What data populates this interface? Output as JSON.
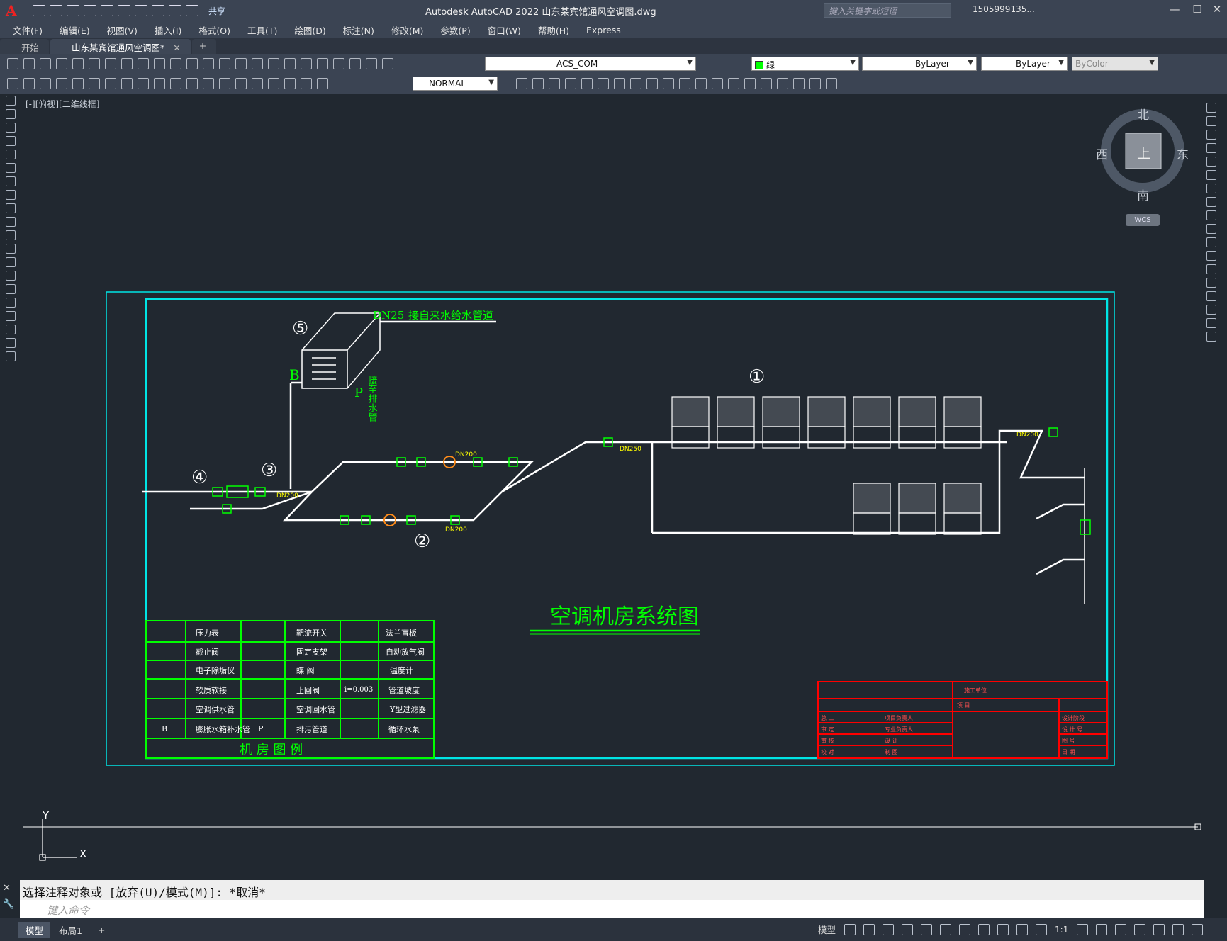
{
  "app": {
    "logo_letter": "A",
    "title": "Autodesk AutoCAD 2022    山东某宾馆通风空调图.dwg",
    "share": "共享",
    "search_placeholder": "键入关键字或短语",
    "user": "1505999135...",
    "window_controls": [
      "—",
      "☐",
      "✕"
    ]
  },
  "menu": [
    "文件(F)",
    "编辑(E)",
    "视图(V)",
    "插入(I)",
    "格式(O)",
    "工具(T)",
    "绘图(D)",
    "标注(N)",
    "修改(M)",
    "参数(P)",
    "窗口(W)",
    "帮助(H)",
    "Express"
  ],
  "tabs": [
    {
      "label": "开始"
    },
    {
      "label": "山东某宾馆通风空调图*"
    }
  ],
  "toolbar": {
    "layer": "ACS_COM",
    "color": "绿",
    "linetype": "ByLayer",
    "lineweight": "ByLayer",
    "plotstyle": "ByColor",
    "textstyle": "NORMAL"
  },
  "viewport": {
    "label": "[-][俯视][二维线框]"
  },
  "viewcube": {
    "north": "北",
    "south": "南",
    "east": "东",
    "west": "西",
    "face": "上",
    "wcs": "WCS"
  },
  "drawing": {
    "title": "空调机房系统图",
    "pipe_labels": {
      "dn25": "DN25",
      "water_supply": "接自来水给水管道",
      "dn200": "DN200",
      "dn250": "DN250",
      "bp_label": "B",
      "p_label": "P",
      "drain": "接至排水管"
    },
    "markers": [
      "①",
      "②",
      "③",
      "④",
      "⑤"
    ],
    "legend": {
      "footer": "机    房    图    例",
      "rows": [
        [
          "压力表",
          "靶流开关",
          "法兰盲板"
        ],
        [
          "截止阀",
          "固定支架",
          "自动放气阀"
        ],
        [
          "电子除垢仪",
          "蝶  阀",
          "温度计"
        ],
        [
          "软质软接",
          "止回阀",
          "管道坡度"
        ],
        [
          "空调供水管",
          "空调回水管",
          "Y型过滤器"
        ],
        [
          "膨胀水箱补水管",
          "排污管道",
          "循环水泵"
        ]
      ],
      "slope_label": "i=0.003"
    },
    "titleblock": {
      "r1": "施工单位",
      "r2": "项  目",
      "rows": [
        [
          "总  工",
          "项目负责人",
          "设计阶段"
        ],
        [
          "审  定",
          "专业负责人",
          "设 计 号"
        ],
        [
          "审  核",
          "设  计",
          "图  号"
        ],
        [
          "校  对",
          "制  图",
          "日  期"
        ]
      ]
    }
  },
  "command": {
    "history": "选择注释对象或 [放弃(U)/模式(M)]: *取消*",
    "placeholder": "键入命令"
  },
  "status": {
    "layout_tabs": [
      "模型",
      "布局1"
    ],
    "model": "模型",
    "scale": "1:1"
  },
  "ucs": {
    "x": "X",
    "y": "Y"
  }
}
